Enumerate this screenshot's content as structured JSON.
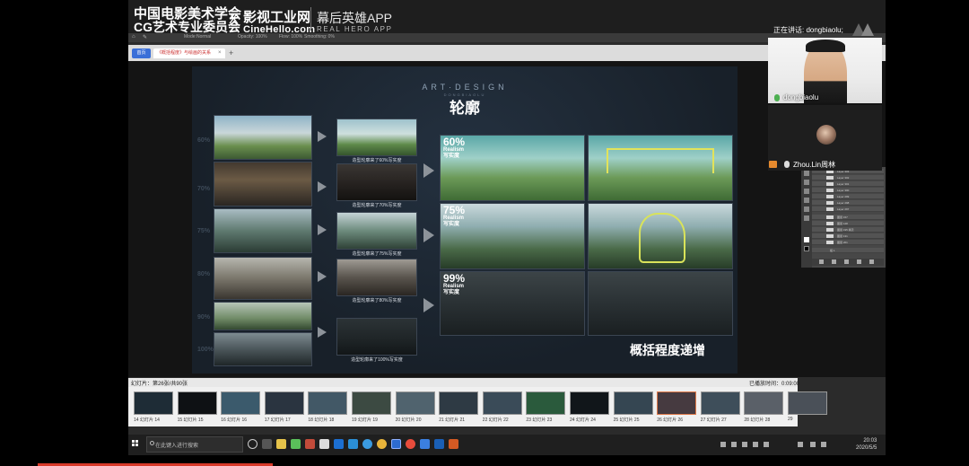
{
  "brand": {
    "org_line1": "中国电影美术学会",
    "org_line2": "CG艺术专业委员会",
    "x": "X",
    "site": "影视工业网",
    "site_url": "CineHello.com",
    "app": "幕后英雄APP",
    "app_en": "REAL HERO APP"
  },
  "ps_options": [
    "Mode:",
    "Normal",
    "Opacity: 100%",
    "Flow: 100%",
    "Smoothing: 0%"
  ],
  "browser": {
    "home_tab": "首页",
    "active_tab": "《概括程度》与绘画的关系",
    "close": "×",
    "add": "+"
  },
  "slide": {
    "art_title": "ART·DESIGN",
    "art_sub": "DONGBIAOLU",
    "title": "轮廓",
    "left_pcts": [
      "60%",
      "70%",
      "75%",
      "80%",
      "90%",
      "100%"
    ],
    "captions": [
      "造型轮廓来了60%写实度",
      "造型轮廓来了70%写实度",
      "造型轮廓来了75%写实度",
      "造型轮廓来了80%写实度",
      "造型轮廓来了100%写实度"
    ],
    "levels": [
      {
        "pct": "60%",
        "en": "Realism",
        "cn": "写实度"
      },
      {
        "pct": "75%",
        "en": "Realism",
        "cn": "写实度"
      },
      {
        "pct": "99%",
        "en": "Realism",
        "cn": "写实度"
      }
    ],
    "bottom_title": "概括程度递增"
  },
  "ps_layers": [
    "Layer 303",
    "Layer 302",
    "Layer 301",
    "Layer 300",
    "Layer 299",
    "Layer 298",
    "Layer 297",
    "图层 157",
    "图层 128",
    "图层 195 拷贝",
    "图层 131",
    "图层 201",
    "组 1"
  ],
  "ppt": {
    "status_left": "幻灯片：第26张/共90张",
    "status_right": "已播放时间：0:09:00",
    "slides": [
      "14 幻灯片 14",
      "15 幻灯片 15",
      "16 幻灯片 16",
      "17 幻灯片 17",
      "18 幻灯片 18",
      "19 幻灯片 19",
      "20 幻灯片 20",
      "21 幻灯片 21",
      "22 幻灯片 22",
      "23 幻灯片 23",
      "24 幻灯片 24",
      "25 幻灯片 25",
      "26 幻灯片 26",
      "27 幻灯片 27",
      "28 幻灯片 28",
      "29"
    ]
  },
  "taskbar": {
    "search_placeholder": "在此键入进行搜索",
    "time": "20:03",
    "date": "2020/5/5"
  },
  "meeting": {
    "now_talking": "正在讲话: dongbiaolu;",
    "speaker_name": "dongbiaolu",
    "participant_name": "Zhou.Lin周林"
  },
  "colors": {
    "accent_blue": "#3a6fd8",
    "progress_red": "#d83a2a",
    "mic_green": "#4caf50"
  }
}
